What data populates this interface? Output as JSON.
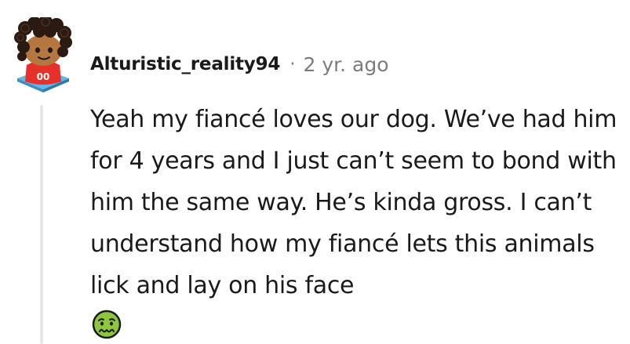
{
  "comment": {
    "author": "Alturistic_reality94",
    "separator": "·",
    "age": "2 yr. ago",
    "body": "Yeah my fiancé loves our dog. We’ve had him for 4 years and I just can’t seem to bond with him the same way. He’s kinda gross. I can’t understand how my fiancé lets this animals lick and lay on his face",
    "avatar": {
      "icon": "snoo-avatar-icon",
      "jersey_text": "00"
    },
    "reaction_emoji": "nauseated-face-icon"
  },
  "colors": {
    "text": "#1a1a1b",
    "meta": "#7c7c7c",
    "thread_line": "#e6e6e6",
    "jersey": "#e8302b",
    "emoji_green": "#8ec63f"
  }
}
